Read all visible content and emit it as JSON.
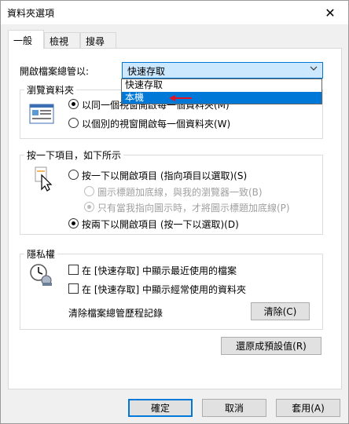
{
  "window": {
    "title": "資料夾選項",
    "close_glyph": "✕"
  },
  "tabs": [
    {
      "label": "一般",
      "active": true
    },
    {
      "label": "檢視",
      "active": false
    },
    {
      "label": "搜尋",
      "active": false
    }
  ],
  "open_explorer": {
    "label": "開啟檔案總管以:",
    "selected": "快速存取",
    "options": [
      "快速存取",
      "本機"
    ],
    "highlighted_option": "本機"
  },
  "browse_folders": {
    "title": "瀏覽資料夾",
    "opt_same": "以同一個視窗開啟每一個資料夾(M)",
    "opt_new": "以個別的視窗開啟每一個資料夾(W)",
    "selected": "opt_same"
  },
  "click_items": {
    "title": "按一下項目，如下所示",
    "opt_single": "按一下以開啟項目 (指向項目以選取)(S)",
    "opt_underline_browser": "圖示標題加底線，與我的瀏覽器一致(B)",
    "opt_underline_point": "只有當我指向圖示時，才將圖示標題加底線(P)",
    "opt_double": "按兩下以開啟項目 (按一下以選取)(D)",
    "selected": "opt_double"
  },
  "privacy": {
    "title": "隱私權",
    "chk_recent_files": "在 [快速存取] 中顯示最近使用的檔案",
    "chk_frequent_folders": "在 [快速存取] 中顯示經常使用的資料夾",
    "recent_checked": false,
    "frequent_checked": false,
    "clear_label": "清除檔案總管歷程記錄",
    "clear_button": "清除(C)"
  },
  "restore_button": "還原成預設值(R)",
  "footer": {
    "ok": "確定",
    "cancel": "取消",
    "apply": "套用(A)"
  },
  "colors": {
    "accent": "#0078d7",
    "highlight_bg": "#cce8ff",
    "annotation_arrow": "#e81123"
  }
}
